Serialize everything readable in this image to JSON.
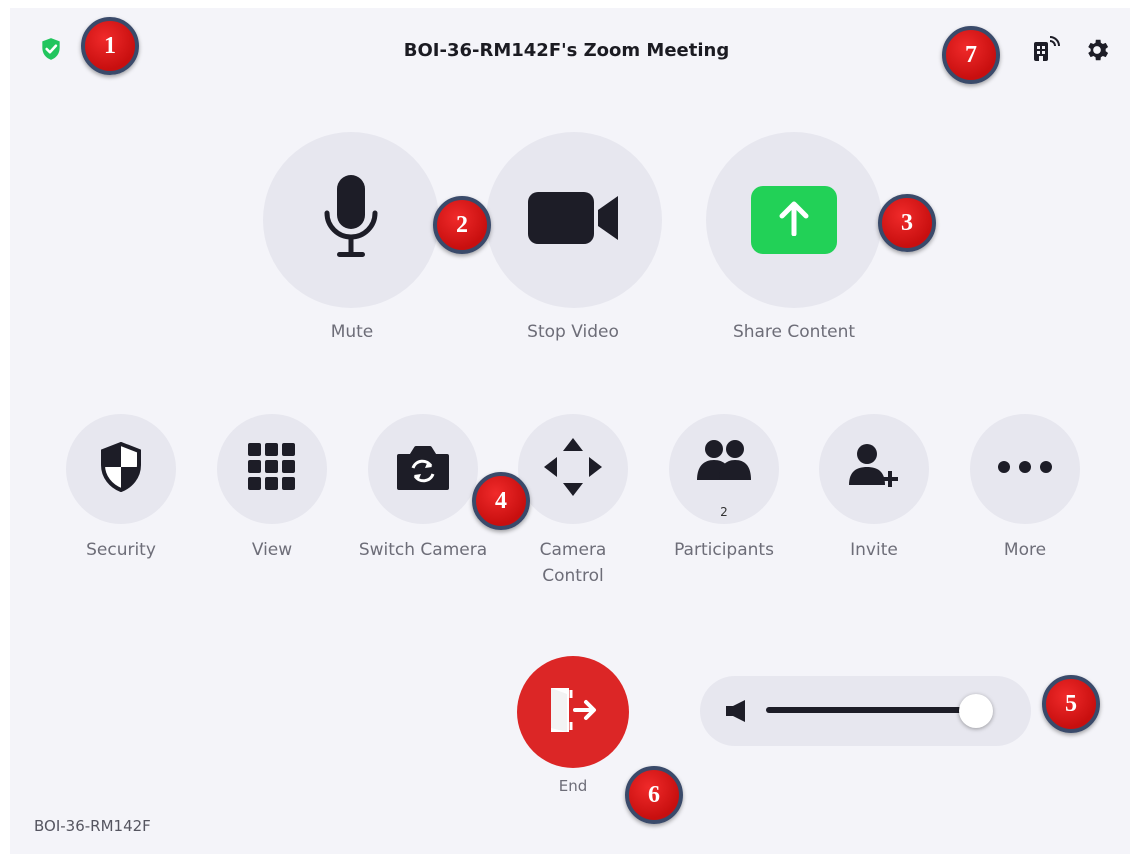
{
  "header": {
    "title": "BOI-36-RM142F's Zoom Meeting",
    "security_status_icon": "shield-check-icon",
    "right_icons": [
      "room-signal-icon",
      "gear-icon"
    ]
  },
  "primary_controls": [
    {
      "label": "Mute",
      "icon": "microphone-icon"
    },
    {
      "label": "Stop Video",
      "icon": "video-camera-icon"
    },
    {
      "label": "Share Content",
      "icon": "share-arrow-icon"
    }
  ],
  "secondary_controls": [
    {
      "label": "Security",
      "icon": "shield-icon"
    },
    {
      "label": "View",
      "icon": "grid-icon"
    },
    {
      "label": "Switch Camera",
      "icon": "switch-camera-icon"
    },
    {
      "label_line1": "Camera",
      "label_line2": "Control",
      "icon": "move-arrows-icon"
    },
    {
      "label": "Participants",
      "icon": "participants-icon",
      "count": "2"
    },
    {
      "label": "Invite",
      "icon": "add-user-icon"
    },
    {
      "label": "More",
      "icon": "more-icon"
    }
  ],
  "end": {
    "label": "End",
    "icon": "exit-door-icon"
  },
  "volume": {
    "icon": "speaker-icon",
    "level_fraction": 0.97
  },
  "room_name": "BOI-36-RM142F",
  "callouts": [
    "1",
    "2",
    "3",
    "4",
    "5",
    "6",
    "7"
  ],
  "colors": {
    "background": "#f4f4f9",
    "button_bg": "#e7e7ef",
    "share_green": "#22d157",
    "end_red": "#dc2626",
    "security_green": "#22c55e",
    "callout_red": "#d91414"
  }
}
